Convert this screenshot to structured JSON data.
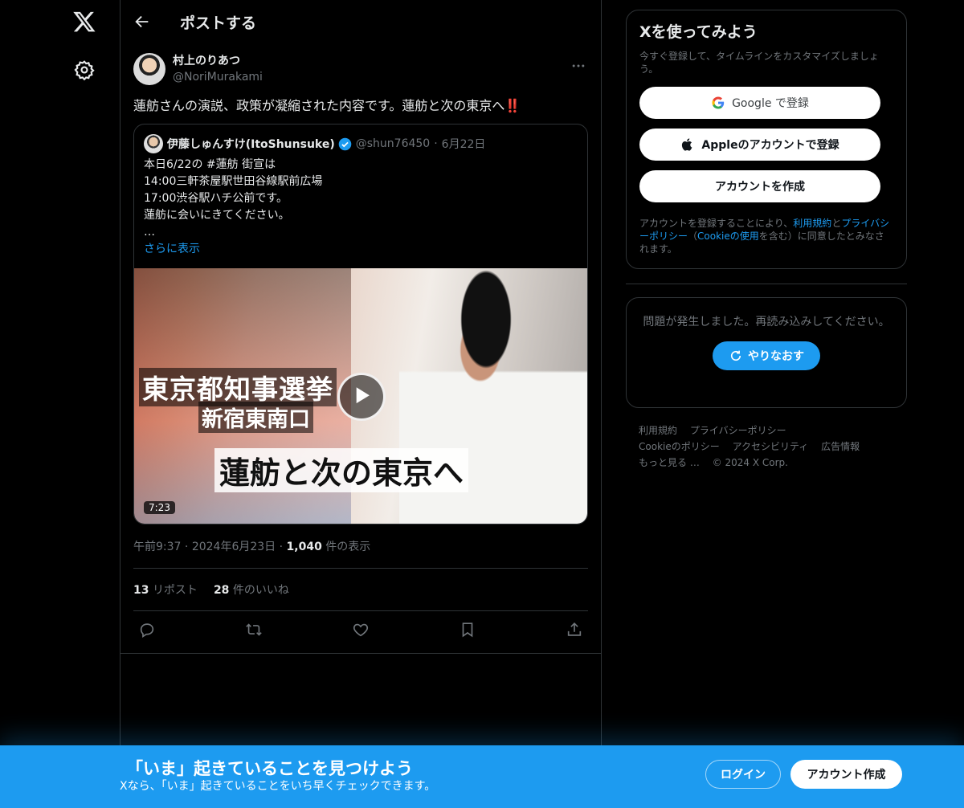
{
  "header": {
    "title": "ポストする"
  },
  "post": {
    "author_name": "村上のりあつ",
    "author_handle": "@NoriMurakami",
    "text": "蓮舫さんの演説、政策が凝縮された内容です。蓮舫と次の東京へ‼️",
    "timestamp": "午前9:37",
    "date": "2024年6月23日",
    "views_count": "1,040",
    "views_label": "件の表示",
    "reposts_count": "13",
    "reposts_label": "リポスト",
    "likes_count": "28",
    "likes_label": "件のいいね"
  },
  "quote": {
    "author_name": "伊藤しゅんすけ(ItoShunsuke)",
    "author_handle": "@shun76450",
    "date": "6月22日",
    "text": "本日6/22の #蓮舫 街宣は\n14:00三軒茶屋駅世田谷線駅前広場\n17:00渋谷駅ハチ公前です。\n蓮舫に会いにきてください。\n…",
    "show_more": "さらに表示",
    "video": {
      "caption_line1": "東京都知事選挙",
      "caption_line2": "新宿東南口",
      "caption_line3": "蓮舫と次の東京へ",
      "duration": "7:23"
    }
  },
  "sidebar": {
    "signup_title": "Xを使ってみよう",
    "signup_sub": "今すぐ登録して、タイムラインをカスタマイズしましょう。",
    "google_button": "Google で登録",
    "apple_button": "Appleのアカウントで登録",
    "create_button": "アカウントを作成",
    "terms_prefix": "アカウントを登録することにより、",
    "terms_link": "利用規約",
    "terms_and": "と",
    "privacy_link": "プライバシーポリシー",
    "terms_paren_open": "（",
    "cookie_link": "Cookieの使用",
    "terms_suffix": "を含む）に同意したとみなされます。",
    "error_text": "問題が発生しました。再読み込みしてください。",
    "retry_button": "やりなおす",
    "footer": [
      "利用規約",
      "プライバシーポリシー",
      "Cookieのポリシー",
      "アクセシビリティ",
      "広告情報",
      "もっと見る …",
      "© 2024 X Corp."
    ]
  },
  "banner": {
    "title": "「いま」起きていることを見つけよう",
    "subtitle": "Xなら、「いま」起きていることをいち早くチェックできます。",
    "login_button": "ログイン",
    "create_button": "アカウント作成"
  },
  "colors": {
    "accent": "#1d9bf0",
    "background": "#000000",
    "border": "#2f3336",
    "muted": "#71767b",
    "alert": "#f4212e"
  }
}
